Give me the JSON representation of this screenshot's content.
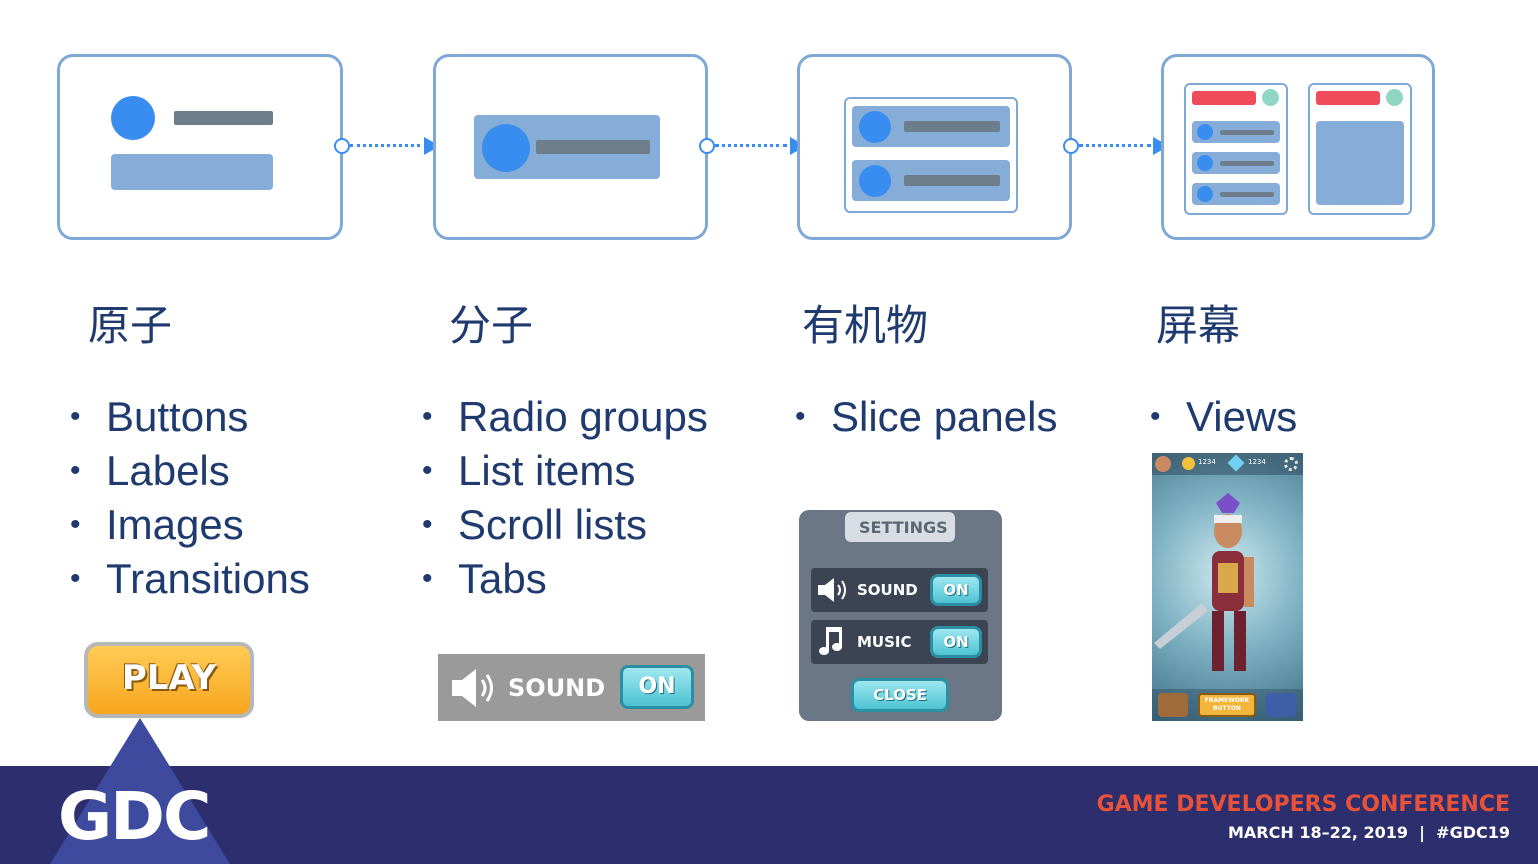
{
  "stages": [
    {
      "heading": "原子",
      "items": [
        "Buttons",
        "Labels",
        "Images",
        "Transitions"
      ]
    },
    {
      "heading": "分子",
      "items": [
        "Radio groups",
        "List items",
        "Scroll lists",
        "Tabs"
      ]
    },
    {
      "heading": "有机物",
      "items": [
        "Slice panels"
      ]
    },
    {
      "heading": "屏幕",
      "items": [
        "Views"
      ]
    }
  ],
  "examples": {
    "play_label": "PLAY",
    "sound_label": "SOUND",
    "on_label": "ON",
    "settings_title": "SETTINGS",
    "music_label": "MUSIC",
    "close_label": "CLOSE",
    "hud_value_1": "1234",
    "hud_value_2": "1234",
    "framework_button": "FRAMEWORK BUTTON"
  },
  "footer": {
    "logo": "GDC",
    "conference": "GAME DEVELOPERS CONFERENCE",
    "dates": "MARCH 18–22, 2019  |  #GDC19"
  },
  "colors": {
    "accent": "#3a8df0",
    "heading_text": "#1e3a6e",
    "footer_bg": "#2c2e6d",
    "conference_text": "#e8523a"
  }
}
